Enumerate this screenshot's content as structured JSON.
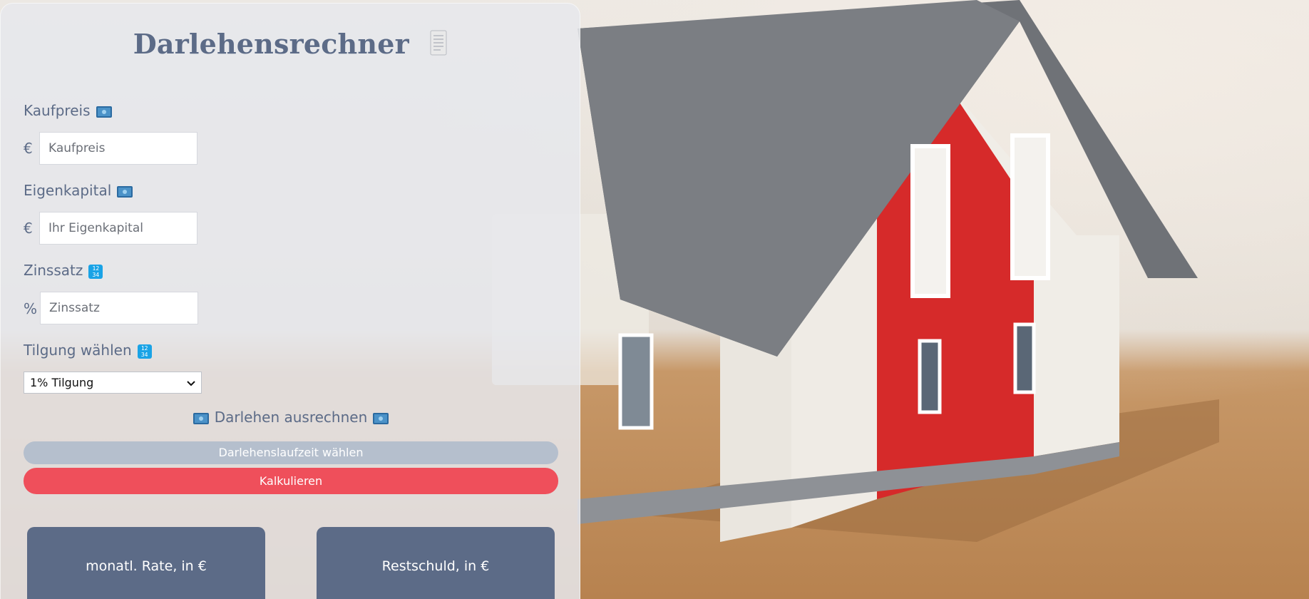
{
  "app": {
    "title": "Darlehensrechner"
  },
  "form": {
    "purchase_price": {
      "label": "Kaufpreis",
      "unit": "€",
      "placeholder": "Kaufpreis",
      "value": ""
    },
    "equity": {
      "label": "Eigenkapital",
      "unit": "€",
      "placeholder": "Ihr Eigenkapital",
      "value": ""
    },
    "interest": {
      "label": "Zinssatz",
      "unit": "%",
      "placeholder": "Zinssatz",
      "value": ""
    },
    "repayment": {
      "label": "Tilgung wählen",
      "selected": "1% Tilgung"
    }
  },
  "calculate": {
    "heading": "Darlehen ausrechnen",
    "term_button": "Darlehenslaufzeit wählen",
    "calc_button": "Kalkulieren"
  },
  "results": {
    "monthly_rate_label": "monatl. Rate, in €",
    "remaining_debt_label": "Restschuld, in €"
  },
  "colors": {
    "primary_text": "#5c6b87",
    "accent_red": "#ef4f5b",
    "pill_gray": "#b5bfcd",
    "card_bg": "#5c6b87"
  },
  "icons": {
    "title_icon": "receipt-icon",
    "purchase_price_icon": "money-icon",
    "equity_icon": "money-icon",
    "interest_icon": "keypad-numbers-icon",
    "repayment_icon": "keypad-numbers-icon"
  }
}
